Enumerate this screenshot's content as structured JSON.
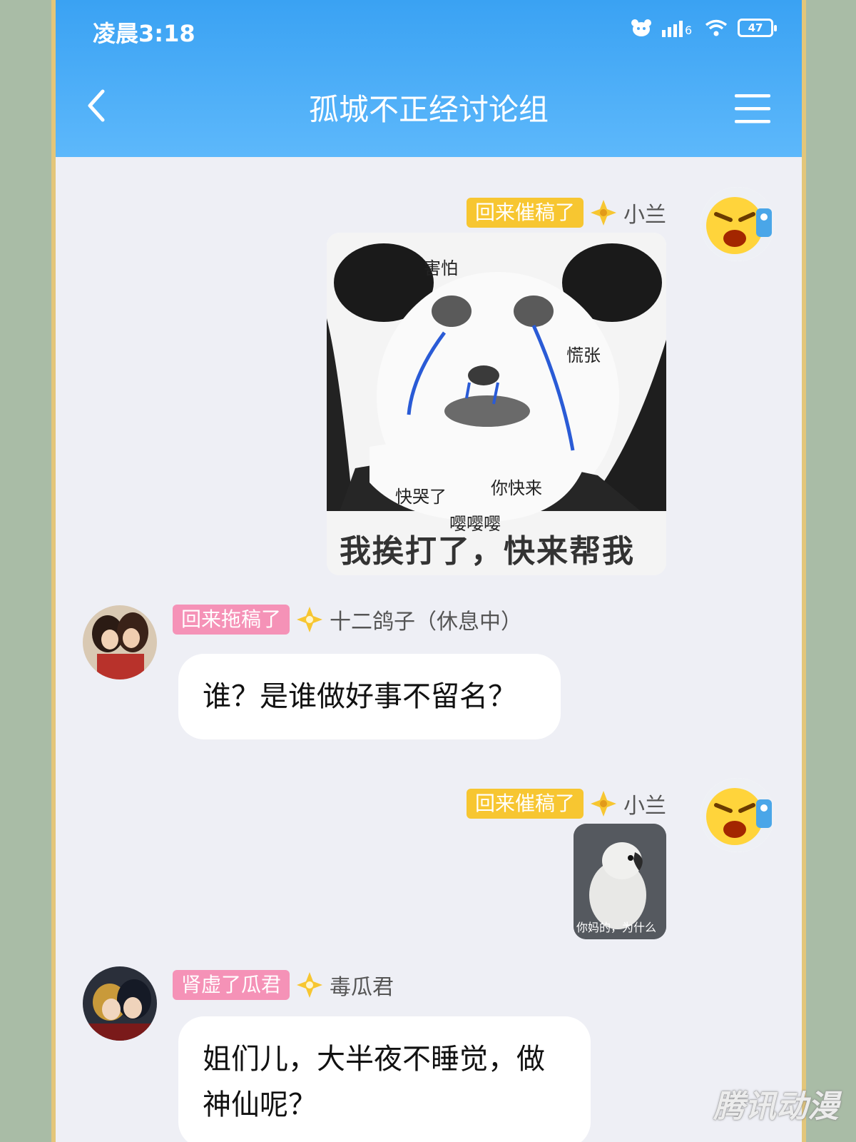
{
  "status": {
    "time": "凌晨3:18",
    "battery": "47"
  },
  "header": {
    "title": "孤城不正经讨论组"
  },
  "messages": [
    {
      "side": "right",
      "badge": "回来催稿了",
      "name": "小兰",
      "type": "image",
      "image_texts": [
        "害怕",
        "慌张",
        "快哭了",
        "你快来",
        "嘤嘤嘤"
      ],
      "image_caption": "我挨打了，快来帮我"
    },
    {
      "side": "left",
      "badge": "回来拖稿了",
      "name": "十二鸽子（休息中）",
      "type": "text",
      "text": "谁？是谁做好事不留名？"
    },
    {
      "side": "right",
      "badge": "回来催稿了",
      "name": "小兰",
      "type": "image",
      "image_caption": "你妈的，为什么"
    },
    {
      "side": "left",
      "badge": "肾虚了瓜君",
      "name": "毒瓜君",
      "type": "text",
      "text": "姐们儿，大半夜不睡觉，做神仙呢？"
    }
  ],
  "watermark": "腾讯动漫",
  "colors": {
    "header": "#3aa2f3",
    "badge_gold": "#f7c631",
    "badge_pink": "#f592b7",
    "frame": "#e3c67a"
  }
}
